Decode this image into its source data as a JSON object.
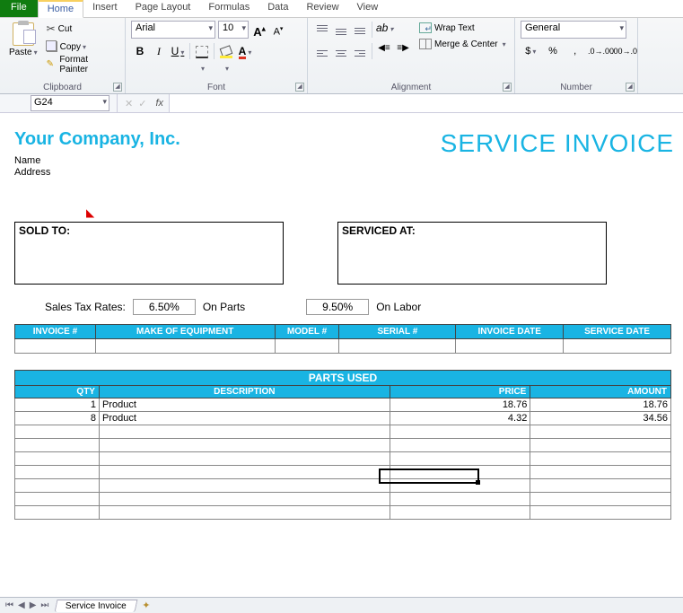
{
  "tabs": {
    "file": "File",
    "home": "Home",
    "insert": "Insert",
    "page_layout": "Page Layout",
    "formulas": "Formulas",
    "data": "Data",
    "review": "Review",
    "view": "View"
  },
  "clipboard": {
    "paste": "Paste",
    "cut": "Cut",
    "copy": "Copy",
    "format_painter": "Format Painter",
    "label": "Clipboard"
  },
  "font": {
    "name": "Arial",
    "size": "10",
    "label": "Font"
  },
  "alignment": {
    "wrap": "Wrap Text",
    "merge": "Merge & Center",
    "label": "Alignment"
  },
  "number": {
    "format": "General",
    "label": "Number"
  },
  "namebox": "G24",
  "fx": "fx",
  "doc": {
    "company": "Your Company, Inc.",
    "title": "SERVICE INVOICE",
    "name_label": "Name",
    "address_label": "Address",
    "sold_to": "SOLD TO:",
    "serviced_at": "SERVICED AT:",
    "tax_label": "Sales Tax Rates:",
    "tax_parts": "6.50%",
    "on_parts": "On Parts",
    "tax_labor": "9.50%",
    "on_labor": "On Labor",
    "hdr": {
      "invoice": "INVOICE #",
      "make": "MAKE OF EQUIPMENT",
      "model": "MODEL #",
      "serial": "SERIAL #",
      "inv_date": "INVOICE DATE",
      "svc_date": "SERVICE DATE"
    },
    "parts_title": "PARTS USED",
    "parts_hdr": {
      "qty": "QTY",
      "desc": "DESCRIPTION",
      "price": "PRICE",
      "amount": "AMOUNT"
    },
    "parts": [
      {
        "qty": "1",
        "desc": "Product",
        "price": "18.76",
        "amount": "18.76"
      },
      {
        "qty": "8",
        "desc": "Product",
        "price": "4.32",
        "amount": "34.56"
      }
    ]
  },
  "sheet_tab": "Service Invoice"
}
